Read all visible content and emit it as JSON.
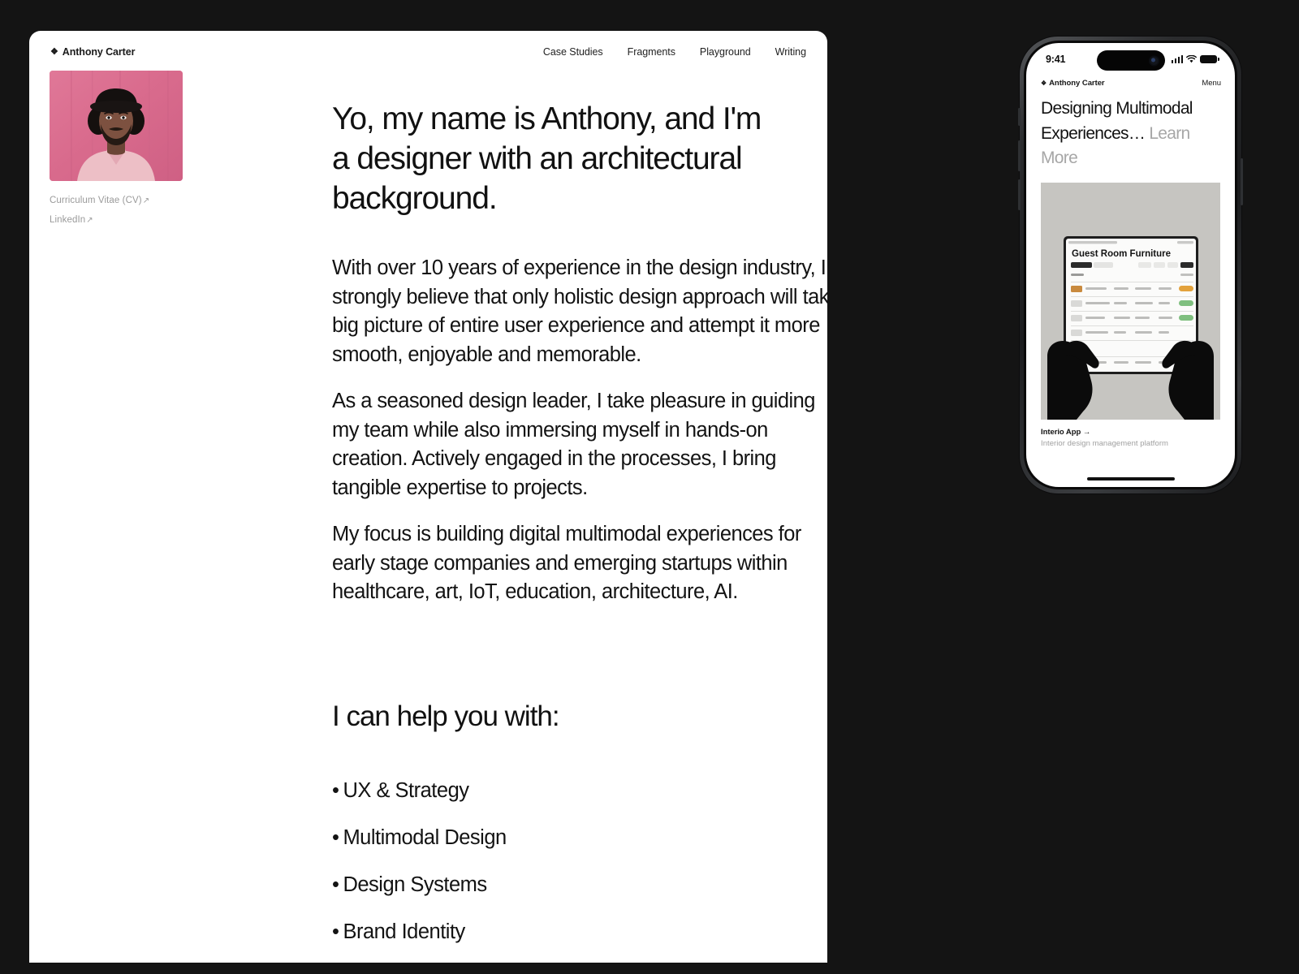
{
  "theme": {
    "page_background": "#141414",
    "card_background": "#ffffff",
    "text_primary": "#131313",
    "text_muted": "#9a9a9a",
    "portrait_pink": "#df6f92"
  },
  "site": {
    "brand_mark": "❖",
    "brand_name": "Anthony Carter",
    "nav": [
      {
        "label": "Case Studies"
      },
      {
        "label": "Fragments"
      },
      {
        "label": "Playground"
      },
      {
        "label": "Writing"
      }
    ],
    "side_links": [
      {
        "label": "Curriculum Vitae (CV)",
        "arrow": "↗"
      },
      {
        "label": "LinkedIn",
        "arrow": "↗"
      }
    ],
    "portrait_alt": "Portrait of Anthony Carter wearing a black bucket hat and pink polo shirt against a pink backdrop",
    "headline": "Yo, my name is Anthony, and I'm a designer with an architectural background.",
    "paragraphs": [
      "With over 10 years of experience in the design industry, I strongly believe that only holistic design approach will take big picture of entire user experience and attempt it more smooth, enjoyable and memorable.",
      "As a seasoned design leader, I take pleasure in guiding my team while also immersing myself in hands-on creation. Actively engaged in the processes, I bring tangible expertise to projects.",
      "My focus is building digital multimodal experiences for early stage companies and emerging startups within healthcare, art, IoT, education, architecture, AI."
    ],
    "help_title": "I can help you with:",
    "help_items": [
      {
        "bullet": "•",
        "label": "UX & Strategy"
      },
      {
        "bullet": "•",
        "label": "Multimodal Design"
      },
      {
        "bullet": "•",
        "label": "Design Systems"
      },
      {
        "bullet": "•",
        "label": "Brand Identity"
      }
    ]
  },
  "phone": {
    "status": {
      "time": "9:41",
      "signal_icon": "cellular-bars-icon",
      "wifi_icon": "wifi-icon",
      "battery_icon": "battery-full-icon"
    },
    "brand_mark": "❖",
    "brand_name": "Anthony Carter",
    "menu_label": "Menu",
    "headline": "Designing Multimodal Experiences…",
    "headline_secondary": "Learn More",
    "figure_alt": "Two hands holding a tablet displaying the Guest Room Furniture table view",
    "figure_screen_title": "Guest Room Furniture",
    "caption_title": "Interio App →",
    "caption_subtitle": "Interior design management platform"
  }
}
